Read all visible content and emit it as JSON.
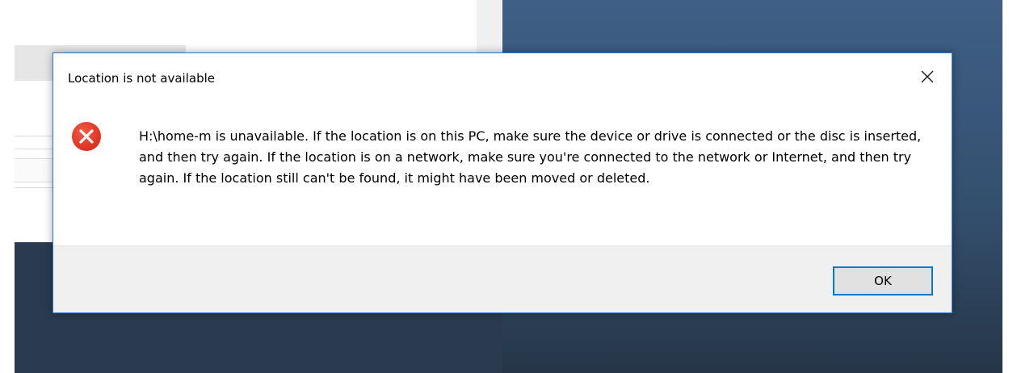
{
  "dialog": {
    "title": "Location is not available",
    "message": "H:\\home-m is unavailable. If the location is on this PC, make sure the device or drive is connected or the disc is inserted, and then try again. If the location is on a network, make sure you're connected to the network or Internet, and then try again. If the location still can't be found, it might have been moved or deleted.",
    "ok_label": "OK",
    "icons": {
      "close": "close-icon",
      "error": "error-icon"
    },
    "colors": {
      "accent": "#0078d7",
      "error": "#e81123",
      "footer_bg": "#f0f0f0"
    }
  }
}
